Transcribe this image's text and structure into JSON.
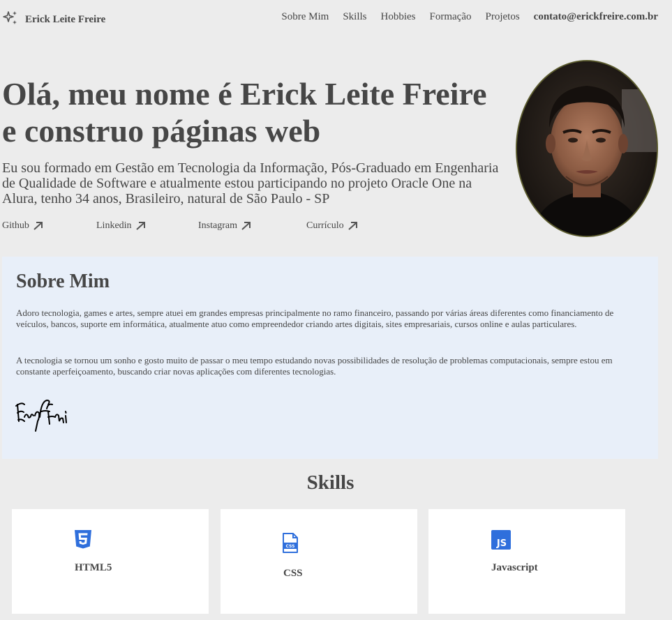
{
  "header": {
    "brand_name": "Erick Leite Freire",
    "nav": [
      "Sobre Mim",
      "Skills",
      "Hobbies",
      "Formação",
      "Projetos"
    ],
    "contact": "contato@erickfreire.com.br"
  },
  "hero": {
    "title": "Olá, meu nome é Erick Leite Freire e construo páginas web",
    "description": "Eu sou formado em Gestão em Tecnologia da Informação, Pós-Graduado em Engenharia de Qualidade de Software e atualmente estou participando no projeto Oracle One na Alura, tenho 34 anos, Brasileiro, natural de São Paulo - SP",
    "links": [
      "Github",
      "Linkedin",
      "Instagram",
      "Currículo"
    ]
  },
  "sobre": {
    "title": "Sobre Mim",
    "paragraph1": "Adoro tecnologia, games e artes, sempre atuei em grandes empresas principalmente no ramo financeiro, passando por várias áreas diferentes como financiamento de veículos, bancos, suporte em informática, atualmente atuo como empreendedor criando artes digitais, sites empresariais, cursos online e aulas particulares.",
    "paragraph2": "A tecnologia se tornou um sonho e gosto muito de passar o meu tempo estudando novas possibilidades de resolução de problemas computacionais, sempre estou em constante aperfeiçoamento, buscando criar novas aplicações com diferentes tecnologias."
  },
  "skills": {
    "title": "Skills",
    "items": [
      {
        "label": "HTML5",
        "icon": "html5-icon"
      },
      {
        "label": "CSS",
        "icon": "css-file-icon"
      },
      {
        "label": "Javascript",
        "icon": "js-icon"
      }
    ]
  },
  "colors": {
    "background": "#ececec",
    "text": "#464646",
    "sobre_bg": "#e8eff9",
    "icon_blue": "#2f6fdc"
  }
}
